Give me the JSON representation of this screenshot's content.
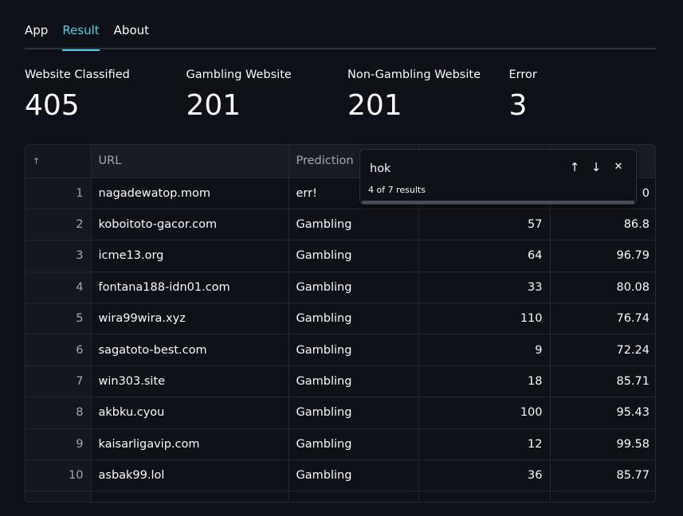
{
  "tabs": [
    {
      "label": "App"
    },
    {
      "label": "Result"
    },
    {
      "label": "About"
    }
  ],
  "metrics": [
    {
      "label": "Website Classified",
      "value": "405"
    },
    {
      "label": "Gambling Website",
      "value": "201"
    },
    {
      "label": "Non-Gambling Website",
      "value": "201"
    },
    {
      "label": "Error",
      "value": "3"
    }
  ],
  "table": {
    "sort_icon": "↑",
    "headers": [
      "URL",
      "Prediction",
      "",
      ""
    ],
    "rows": [
      {
        "idx": "1",
        "url": "nagadewatop.mom",
        "prediction": "err!",
        "c3": "",
        "c4": "0"
      },
      {
        "idx": "2",
        "url": "koboitoto-gacor.com",
        "prediction": "Gambling",
        "c3": "57",
        "c4": "86.8"
      },
      {
        "idx": "3",
        "url": "icme13.org",
        "prediction": "Gambling",
        "c3": "64",
        "c4": "96.79"
      },
      {
        "idx": "4",
        "url": "fontana188-idn01.com",
        "prediction": "Gambling",
        "c3": "33",
        "c4": "80.08"
      },
      {
        "idx": "5",
        "url": "wira99wira.xyz",
        "prediction": "Gambling",
        "c3": "110",
        "c4": "76.74"
      },
      {
        "idx": "6",
        "url": "sagatoto-best.com",
        "prediction": "Gambling",
        "c3": "9",
        "c4": "72.24"
      },
      {
        "idx": "7",
        "url": "win303.site",
        "prediction": "Gambling",
        "c3": "18",
        "c4": "85.71"
      },
      {
        "idx": "8",
        "url": "akbku.cyou",
        "prediction": "Gambling",
        "c3": "100",
        "c4": "95.43"
      },
      {
        "idx": "9",
        "url": "kaisarligavip.com",
        "prediction": "Gambling",
        "c3": "12",
        "c4": "99.58"
      },
      {
        "idx": "10",
        "url": "asbak99.lol",
        "prediction": "Gambling",
        "c3": "36",
        "c4": "85.77"
      }
    ]
  },
  "search": {
    "query": "hok",
    "result_count": "4 of 7 results",
    "up_icon": "↑",
    "down_icon": "↓",
    "close_icon": "✕"
  },
  "colors": {
    "background": "#0e1117",
    "accent": "#4fd1e8",
    "header_bg": "#1a1c24",
    "border": "#262730"
  }
}
